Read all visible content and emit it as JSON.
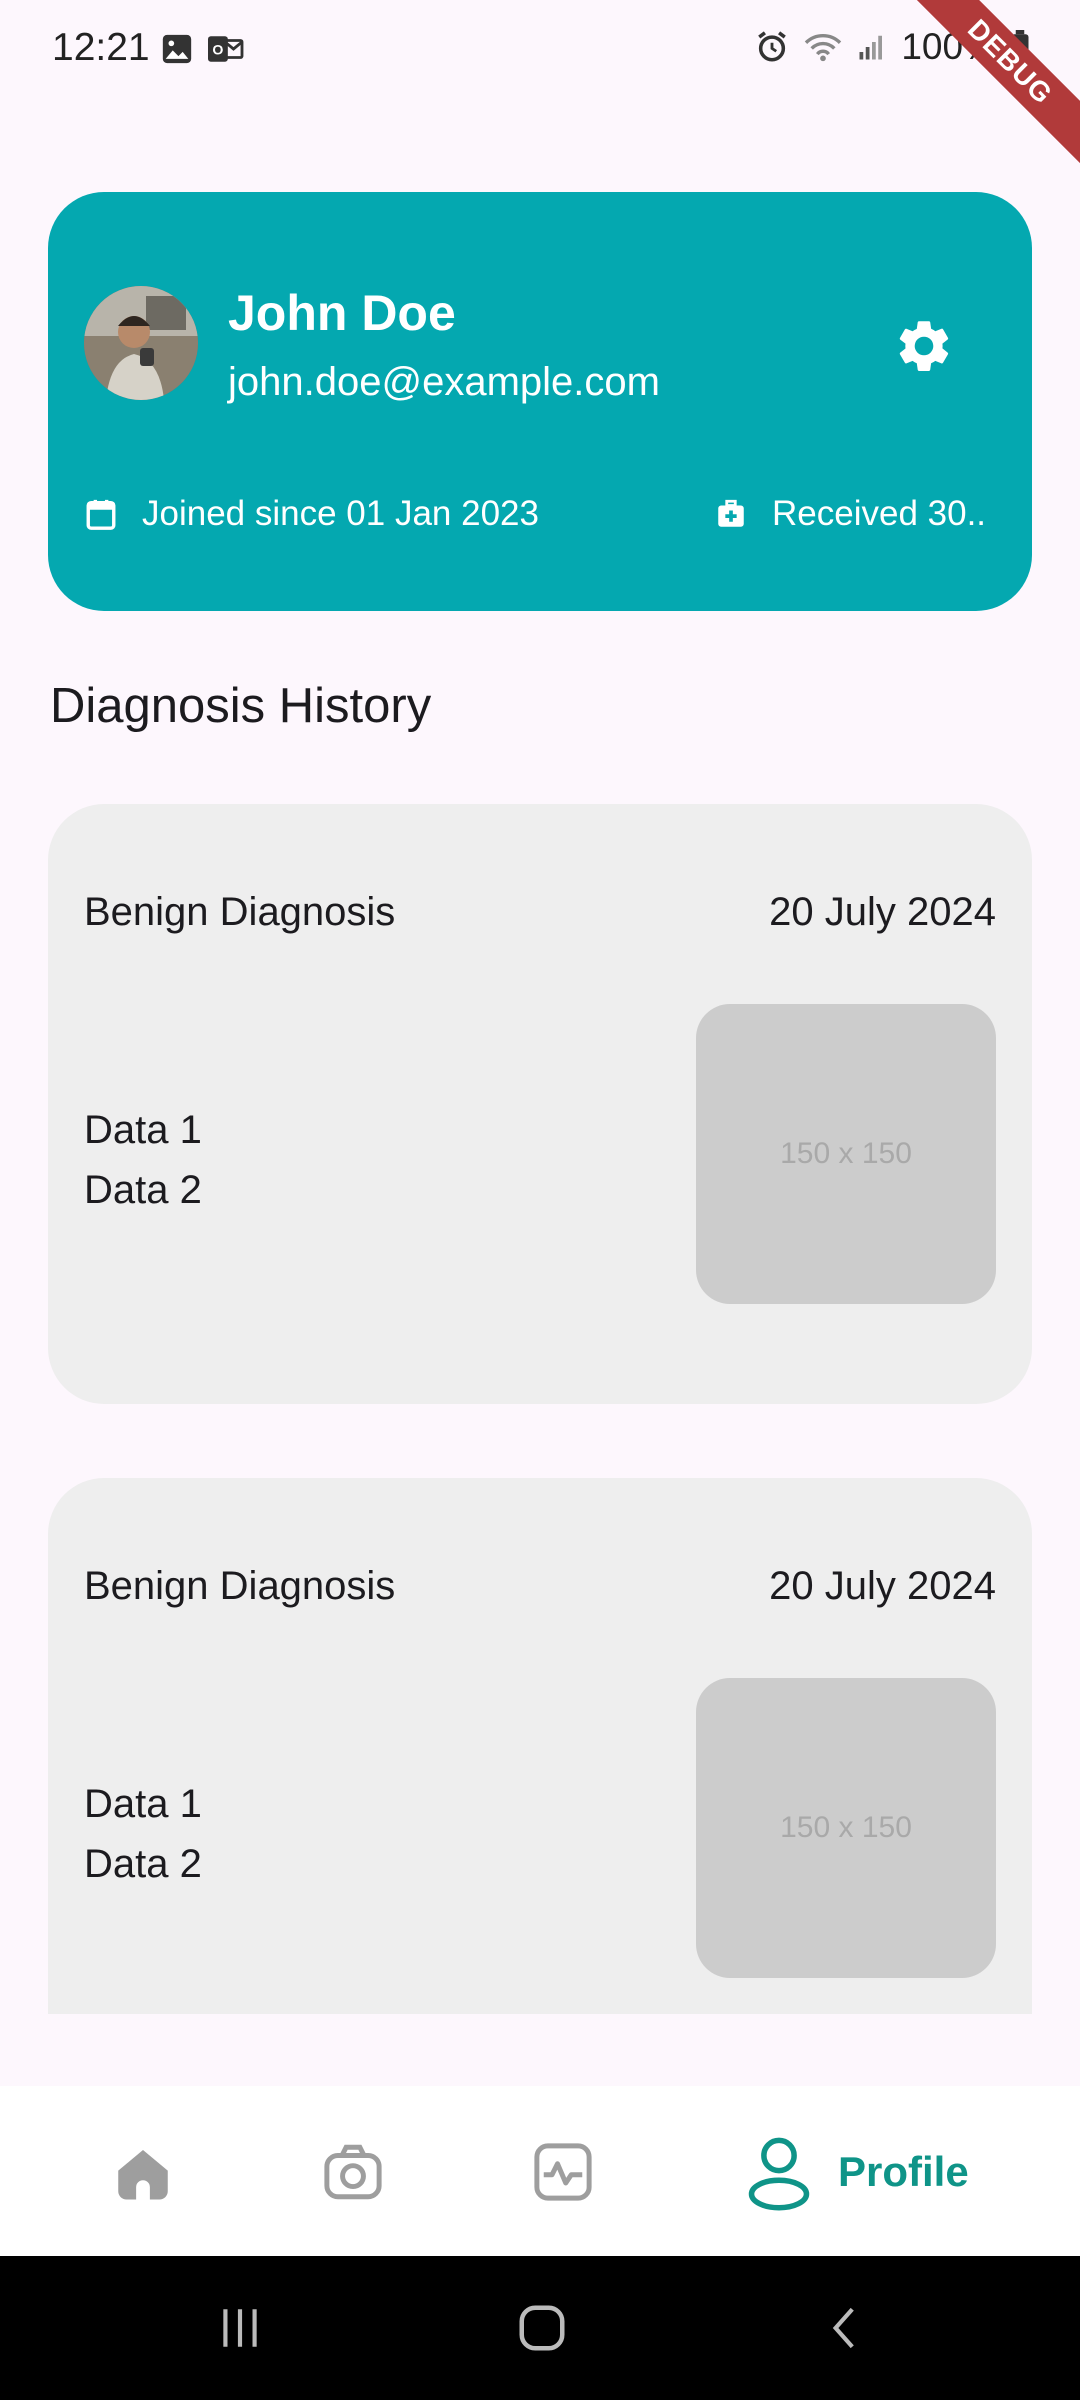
{
  "status_bar": {
    "time": "12:21",
    "battery": "100%",
    "debug_banner": "DEBUG"
  },
  "profile": {
    "name": "John Doe",
    "email": "john.doe@example.com",
    "joined": "Joined since 01 Jan 2023",
    "received": "Received 30..",
    "accent_color": "#04a8b0"
  },
  "section_title": "Diagnosis History",
  "diagnoses": [
    {
      "title": "Benign Diagnosis",
      "date": "20 July 2024",
      "data_lines": [
        "Data 1",
        "Data 2"
      ],
      "image_placeholder": "150 x 150"
    },
    {
      "title": "Benign Diagnosis",
      "date": "20 July 2024",
      "data_lines": [
        "Data 1",
        "Data 2"
      ],
      "image_placeholder": "150 x 150"
    }
  ],
  "bottom_nav": {
    "items": [
      {
        "icon": "home-icon"
      },
      {
        "icon": "camera-icon"
      },
      {
        "icon": "activity-icon"
      },
      {
        "icon": "profile-icon",
        "label": "Profile",
        "active": true
      }
    ],
    "active_color": "#0f9488"
  }
}
